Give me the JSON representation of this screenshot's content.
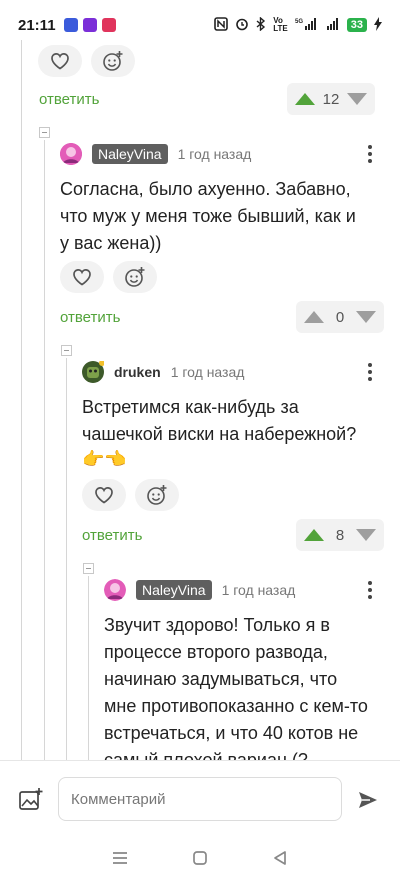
{
  "status_bar": {
    "time": "21:11",
    "network": "5G",
    "battery": "33"
  },
  "comments": [
    {
      "reply_label": "ответить",
      "rating": "12"
    },
    {
      "author": "NaleyVina",
      "time": "1 год назад",
      "text": "Согласна, было ахуенно. Забавно, что муж у меня тоже бывший, как и у вас жена))",
      "reply_label": "ответить",
      "rating": "0"
    },
    {
      "author": "druken",
      "time": "1 год назад",
      "text": "Встретимся как-нибудь за чашечкой виски на набережной?",
      "emoji": "👉👈",
      "reply_label": "ответить",
      "rating": "8"
    },
    {
      "author": "NaleyVina",
      "time": "1 год назад",
      "text": "Звучит здорово! Только я в процессе второго развода, начинаю задумываться, что мне противопоказанно с кем-то встречаться, и что 40 котов не самый плохой вариан (?"
    }
  ],
  "comment_input": {
    "placeholder": "Комментарий"
  },
  "icons": {
    "like": "heart-icon",
    "reaction": "add-reaction-icon",
    "attach": "add-image-icon",
    "send": "send-icon"
  },
  "colors": {
    "reply": "#52a33a",
    "upvote_active": "#52a33a",
    "badge": "#5f5f5f"
  }
}
